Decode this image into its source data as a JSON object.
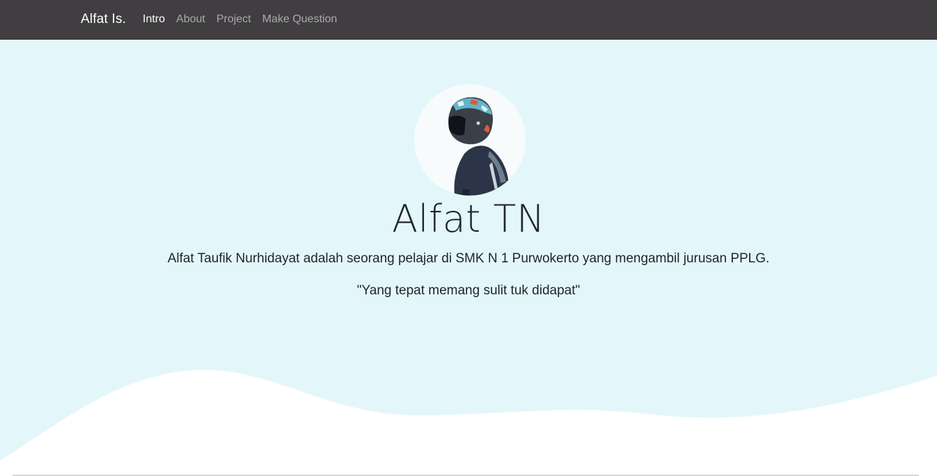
{
  "navbar": {
    "brand": "Alfat Is.",
    "links": [
      {
        "label": "Intro",
        "active": true
      },
      {
        "label": "About",
        "active": false
      },
      {
        "label": "Project",
        "active": false
      },
      {
        "label": "Make Question",
        "active": false
      }
    ]
  },
  "hero": {
    "title": "Alfat TN",
    "description": "Alfat Taufik Nurhidayat adalah seorang pelajar di SMK N 1 Purwokerto yang mengambil jurusan PPLG.",
    "quote": "\"Yang tepat memang sulit tuk didapat\""
  },
  "colors": {
    "navbar_bg": "#403e40",
    "hero_bg": "#e3f7fb",
    "wave_fill": "#ffffff"
  }
}
